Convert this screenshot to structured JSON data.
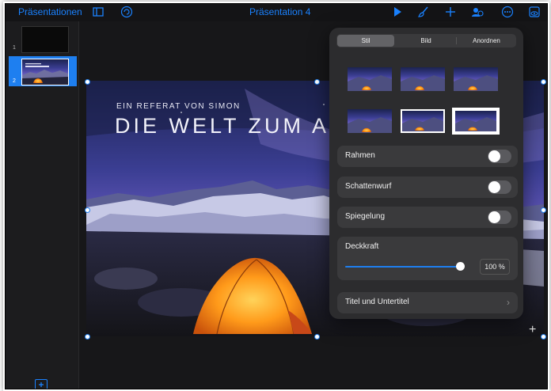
{
  "toolbar": {
    "back_label": "Präsentationen",
    "document_title": "Präsentation 4",
    "icons": [
      "slides-panel-icon",
      "undo-icon",
      "play-icon",
      "format-brush-icon",
      "add-icon",
      "collaborate-icon",
      "more-icon",
      "view-icon"
    ]
  },
  "sidebar": {
    "slides": [
      {
        "number": "1"
      },
      {
        "number": "2",
        "selected": true
      }
    ],
    "add_icon": "add-slide-icon"
  },
  "slide": {
    "subtitle": "EIN REFERAT VON SIMON",
    "title": "DIE WELT ZUM AN"
  },
  "format_popover": {
    "tabs": [
      "Stil",
      "Bild",
      "Anordnen"
    ],
    "active_tab": "Stil",
    "style_presets_count": 6,
    "selected_preset": 6,
    "rows": {
      "border": {
        "label": "Rahmen",
        "on": false
      },
      "shadow": {
        "label": "Schattenwurf",
        "on": false
      },
      "reflection": {
        "label": "Spiegelung",
        "on": false
      }
    },
    "opacity": {
      "label": "Deckkraft",
      "value": "100 %",
      "fraction": 1.0
    },
    "title_row": {
      "label": "Titel und Untertitel"
    }
  },
  "colors": {
    "accent": "#1e7ff0",
    "popover_bg": "#2c2c2e",
    "row_bg": "#3a3a3c"
  }
}
